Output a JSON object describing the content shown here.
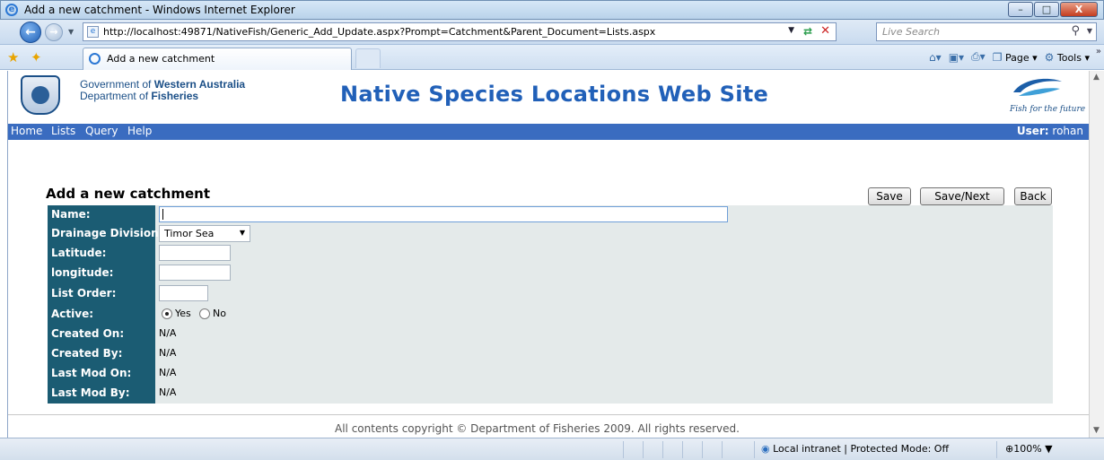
{
  "window": {
    "title": "Add a new catchment - Windows Internet Explorer",
    "minimize": "–",
    "maximize": "□",
    "close": "X"
  },
  "address": {
    "url": "http://localhost:49871/NativeFish/Generic_Add_Update.aspx?Prompt=Catchment&Parent_Document=Lists.aspx",
    "search_placeholder": "Live Search"
  },
  "tabbar": {
    "active_tab": "Add a new catchment",
    "commands": [
      {
        "label": "",
        "icon": "home-icon",
        "glyph": "⌂▾"
      },
      {
        "label": "",
        "icon": "feeds-icon",
        "glyph": "▣▾"
      },
      {
        "label": "",
        "icon": "print-icon",
        "glyph": "⎙▾"
      },
      {
        "label": "Page ▾",
        "icon": "page-icon",
        "glyph": "❐"
      },
      {
        "label": "Tools ▾",
        "icon": "tools-icon",
        "glyph": "⚙"
      }
    ]
  },
  "site": {
    "govt_line1_prefix": "Government of ",
    "govt_line1_bold": "Western Australia",
    "govt_line2_prefix": "Department of ",
    "govt_line2_bold": "Fisheries",
    "title": "Native Species Locations Web Site",
    "tagline": "Fish for the future",
    "menu": [
      "Home",
      "Lists",
      "Query",
      "Help"
    ],
    "user_label": "User:",
    "user_name": "rohan"
  },
  "form": {
    "title": "Add a new catchment",
    "buttons": {
      "save": "Save",
      "save_next": "Save/Next",
      "back": "Back"
    },
    "labels": {
      "name": "Name:",
      "drainage": "Drainage Division:",
      "latitude": "Latitude:",
      "longitude": "longitude:",
      "list_order": "List Order:",
      "active": "Active:",
      "created_on": "Created On:",
      "created_by": "Created By:",
      "last_mod_on": "Last Mod On:",
      "last_mod_by": "Last Mod By:"
    },
    "values": {
      "name": "",
      "drainage": "Timor Sea",
      "latitude": "",
      "longitude": "",
      "list_order": "",
      "active_yes": "Yes",
      "active_no": "No",
      "active_selected": "Yes",
      "created_on": "N/A",
      "created_by": "N/A",
      "last_mod_on": "N/A",
      "last_mod_by": "N/A"
    }
  },
  "footer": {
    "text": "All contents copyright © Department of Fisheries 2009. All rights reserved."
  },
  "status": {
    "zone": "Local intranet | Protected Mode: Off",
    "zoom": "100%"
  },
  "colors": {
    "menubar": "#3a6cc0",
    "label_column": "#1b5c73",
    "form_panel": "#e4eaea",
    "site_title": "#2160b8"
  }
}
